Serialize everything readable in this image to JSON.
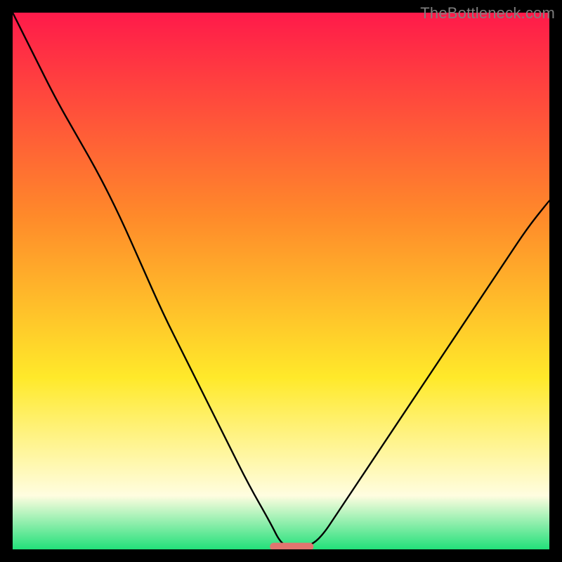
{
  "watermark": "TheBottleneck.com",
  "colors": {
    "frame": "#000000",
    "curve": "#000000",
    "gradient_top": "#ff1a4a",
    "gradient_mid1": "#ff8a2a",
    "gradient_mid2": "#ffe92a",
    "gradient_mid3": "#fffde0",
    "gradient_bottom": "#22e07a",
    "marker_fill": "#e2756f",
    "marker_stroke": "#e2756f",
    "watermark_text": "#7e7e7e"
  },
  "chart_data": {
    "type": "line",
    "title": "",
    "xlabel": "",
    "ylabel": "",
    "xlim": [
      0,
      100
    ],
    "ylim": [
      0,
      100
    ],
    "series": [
      {
        "name": "bottleneck-curve",
        "x": [
          0,
          4,
          8,
          12,
          16,
          20,
          24,
          28,
          32,
          36,
          40,
          44,
          48,
          50,
          52,
          54,
          56,
          58,
          60,
          64,
          68,
          72,
          76,
          80,
          84,
          88,
          92,
          96,
          100
        ],
        "y": [
          100.0,
          92.0,
          84.0,
          77.0,
          70.0,
          62.0,
          53.0,
          44.0,
          36.0,
          28.0,
          20.0,
          12.0,
          5.0,
          1.0,
          0.5,
          0.5,
          1.0,
          3.0,
          6.0,
          12.0,
          18.0,
          24.0,
          30.0,
          36.0,
          42.0,
          48.0,
          54.0,
          60.0,
          65.0
        ]
      }
    ],
    "marker": {
      "name": "optimal-region",
      "x_center": 52,
      "width": 8,
      "y": 0.5,
      "shape": "rounded-bar"
    },
    "gradient_background": true
  }
}
